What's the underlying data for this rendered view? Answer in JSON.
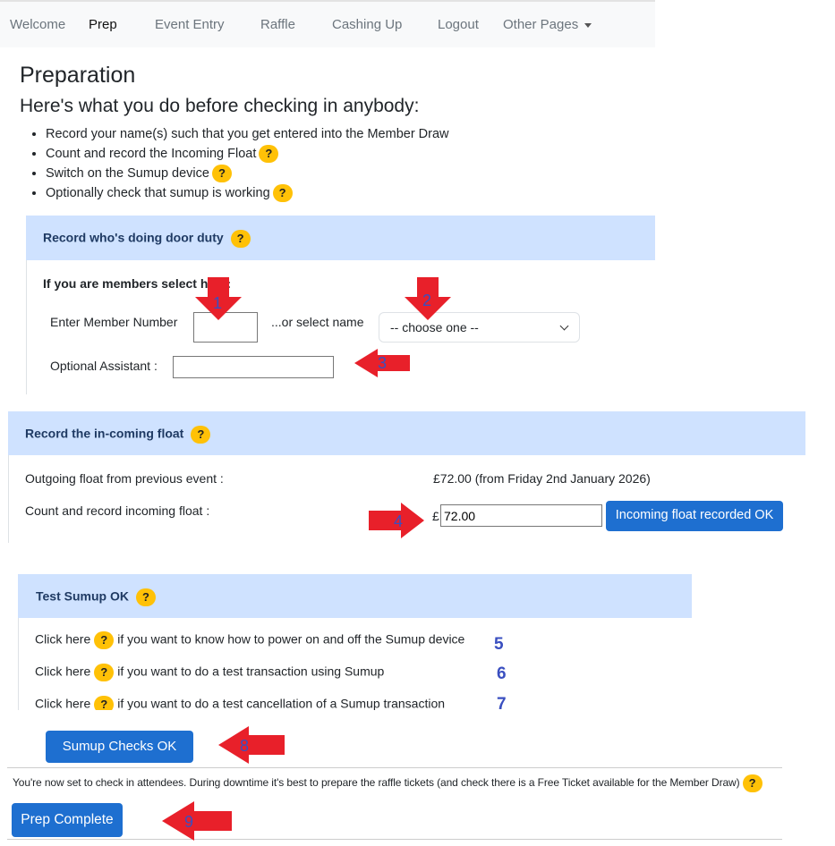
{
  "nav": {
    "items": [
      "Welcome",
      "Prep",
      "Event Entry",
      "Raffle",
      "Cashing Up",
      "Logout",
      "Other Pages"
    ],
    "active": "Prep"
  },
  "page": {
    "title": "Preparation",
    "subtitle": "Here's what you do before checking in anybody:",
    "steps": [
      "Record your name(s) such that you get entered into the Member Draw",
      "Count and record the Incoming Float",
      "Switch on the Sumup device",
      "Optionally check that sumup is working"
    ]
  },
  "help_icon": "?",
  "door_duty": {
    "header": "Record who's doing door duty",
    "members_prompt": "If you are members select here:",
    "member_number_label": "Enter Member Number",
    "member_number_value": "",
    "or_select_label": "...or select name",
    "select_value": "-- choose one --",
    "assistant_label": "Optional Assistant :",
    "assistant_value": ""
  },
  "float": {
    "header": "Record the in-coming float",
    "outgoing_label": "Outgoing float from previous event :",
    "outgoing_value": "£72.00 (from Friday 2nd January 2026)",
    "incoming_label": "Count and record incoming float :",
    "currency_symbol": "£",
    "incoming_value": "72.00",
    "button_label": "Incoming float recorded OK"
  },
  "sumup": {
    "header": "Test Sumup OK",
    "click_here": "Click here",
    "tests": [
      "if you want to know how to power on and off the Sumup device",
      "if you want to do a test transaction using Sumup",
      "if you want to do a test cancellation of a Sumup transaction"
    ],
    "button_label": "Sumup Checks OK"
  },
  "final": {
    "message": "You're now set to check in attendees. During downtime it's best to prepare the raffle tickets (and check there is a Free Ticket available for the Member Draw)",
    "button_label": "Prep Complete"
  },
  "annotations": {
    "color": "#e8202a",
    "number_color": "#3a4fc0",
    "labels": [
      "1",
      "2",
      "3",
      "4",
      "5",
      "6",
      "7",
      "8",
      "9"
    ]
  }
}
